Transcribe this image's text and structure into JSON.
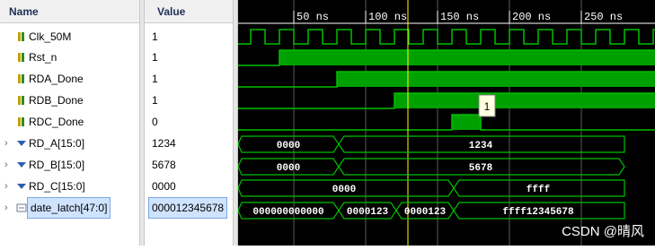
{
  "columns": {
    "name": "Name",
    "value": "Value"
  },
  "signals": [
    {
      "name": "Clk_50M",
      "value": "1",
      "bus": false
    },
    {
      "name": "Rst_n",
      "value": "1",
      "bus": false
    },
    {
      "name": "RDA_Done",
      "value": "1",
      "bus": false
    },
    {
      "name": "RDB_Done",
      "value": "1",
      "bus": false
    },
    {
      "name": "RDC_Done",
      "value": "0",
      "bus": false
    },
    {
      "name": "RD_A[15:0]",
      "value": "1234",
      "bus": true
    },
    {
      "name": "RD_B[15:0]",
      "value": "5678",
      "bus": true
    },
    {
      "name": "RD_C[15:0]",
      "value": "0000",
      "bus": true
    },
    {
      "name": "date_latch[47:0]",
      "value": "000012345678",
      "bus": true,
      "selected": true
    }
  ],
  "timeline": {
    "ticks": [
      "50 ns",
      "100 ns",
      "150 ns",
      "200 ns",
      "250 ns"
    ],
    "tooltip": "1"
  },
  "waves": {
    "rd_a": [
      "0000",
      "1234"
    ],
    "rd_b": [
      "0000",
      "5678"
    ],
    "rd_c": [
      "0000",
      "ffff"
    ],
    "date_latch": [
      "000000000000",
      "0000123",
      "0000123",
      "ffff12345678"
    ]
  },
  "watermark": "CSDN @晴风 ",
  "colors": {
    "wave": "#00c000",
    "bus_text": "#ffffff",
    "cursor": "#ffff00",
    "grid": "#5a5a5a",
    "tooltip_bg": "#ffffe1"
  }
}
